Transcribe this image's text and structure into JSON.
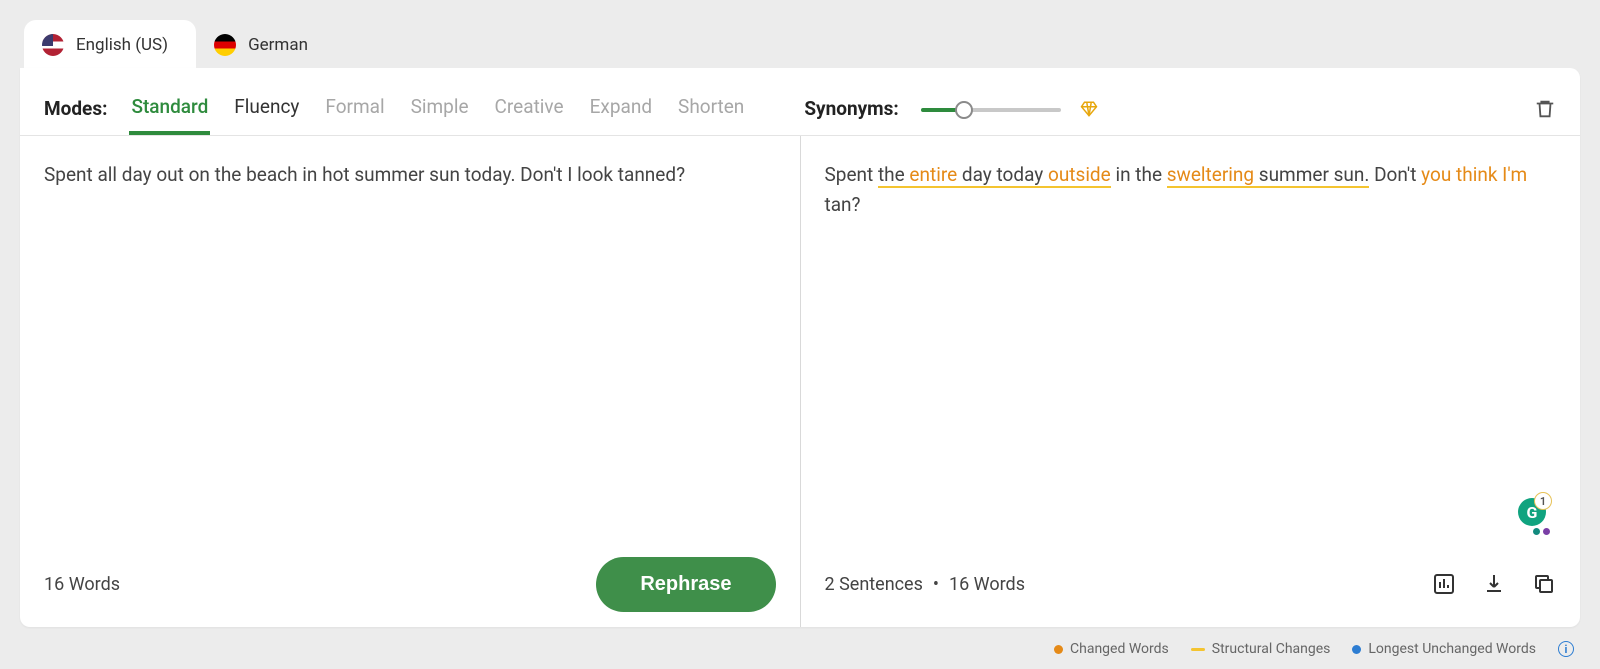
{
  "lang_tabs": {
    "english": "English (US)",
    "german": "German"
  },
  "toolbar": {
    "modes_label": "Modes:",
    "modes": {
      "standard": "Standard",
      "fluency": "Fluency",
      "formal": "Formal",
      "simple": "Simple",
      "creative": "Creative",
      "expand": "Expand",
      "shorten": "Shorten"
    },
    "synonyms_label": "Synonyms:"
  },
  "input": {
    "text": "Spent all day out on the beach in hot summer sun today. Don't I look tanned?",
    "word_count": "16 Words",
    "button": "Rephrase"
  },
  "output": {
    "segments": {
      "s0": "Spent ",
      "s1": "the ",
      "s2": "entire",
      "s3": " day today ",
      "s4": "outside",
      "s5": " in the ",
      "s6": "sweltering",
      "s7": " summer sun.",
      "s8": " Don't ",
      "s9": "you think I'm",
      "s10": " tan?"
    },
    "sentence_count": "2 Sentences",
    "word_count": "16 Words"
  },
  "legend": {
    "changed": "Changed Words",
    "structural": "Structural Changes",
    "unchanged": "Longest Unchanged Words"
  },
  "grammarly_badge": "1"
}
